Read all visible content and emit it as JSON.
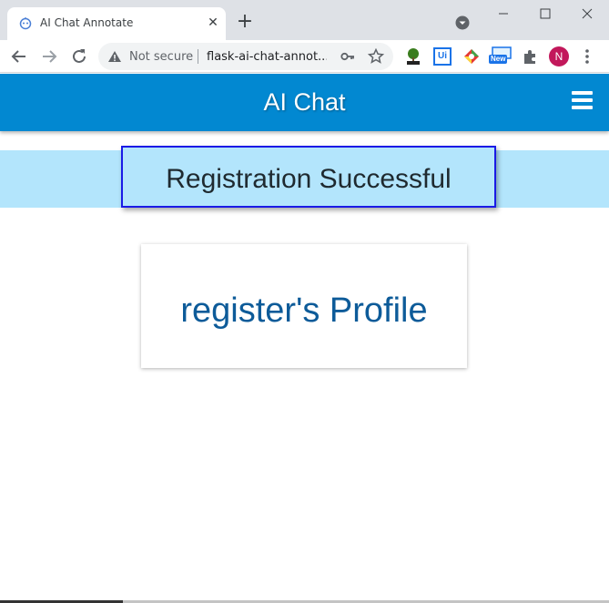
{
  "browser": {
    "tab": {
      "title": "AI Chat Annotate",
      "close_glyph": "✕",
      "favicon": "robot-icon"
    },
    "new_tab_glyph": "+",
    "omnibox": {
      "security_label": "Not secure",
      "url": "flask-ai-chat-annot..."
    },
    "profile_initial": "N",
    "extensions": [
      {
        "name": "html-tree-extension"
      },
      {
        "name": "ui-extension",
        "label": "Ui"
      },
      {
        "name": "color-extension"
      },
      {
        "name": "new-extension",
        "badge": "New"
      },
      {
        "name": "puzzle-icon"
      }
    ]
  },
  "app": {
    "title": "AI Chat",
    "menu_icon": "hamburger-icon",
    "colors": {
      "header": "#0288d1",
      "banner": "#b3e5fc",
      "profile_text": "#0d5b99"
    }
  },
  "banner": {
    "message": "Registration Successful"
  },
  "profile": {
    "title": "register's Profile"
  }
}
